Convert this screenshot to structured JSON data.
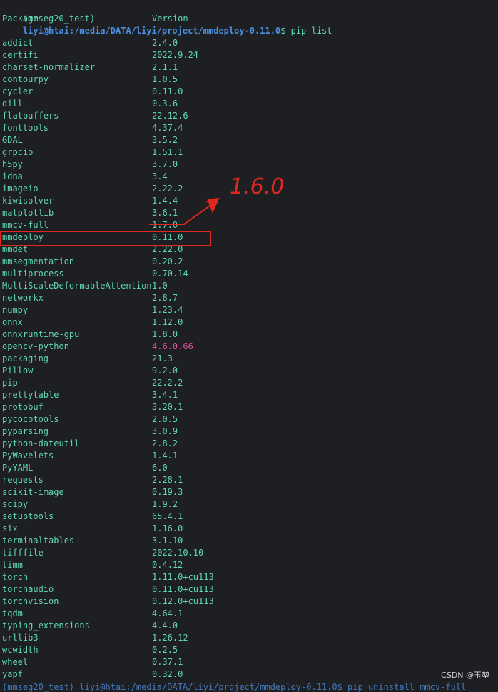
{
  "prompt": {
    "env": "(mmseg20_test)",
    "user_host": "liyi@htai",
    "path": ":/media/DATA/liyi/project/mmdeploy-0.11.0",
    "command": "$ pip list"
  },
  "table": {
    "header_package": "Package",
    "header_version": "Version",
    "separator_package": "------------------------------",
    "separator_version": "------------",
    "rows": [
      {
        "name": "addict",
        "version": "2.4.0"
      },
      {
        "name": "certifi",
        "version": "2022.9.24"
      },
      {
        "name": "charset-normalizer",
        "version": "2.1.1"
      },
      {
        "name": "contourpy",
        "version": "1.0.5"
      },
      {
        "name": "cycler",
        "version": "0.11.0"
      },
      {
        "name": "dill",
        "version": "0.3.6"
      },
      {
        "name": "flatbuffers",
        "version": "22.12.6"
      },
      {
        "name": "fonttools",
        "version": "4.37.4"
      },
      {
        "name": "GDAL",
        "version": "3.5.2"
      },
      {
        "name": "grpcio",
        "version": "1.51.1"
      },
      {
        "name": "h5py",
        "version": "3.7.0"
      },
      {
        "name": "idna",
        "version": "3.4"
      },
      {
        "name": "imageio",
        "version": "2.22.2"
      },
      {
        "name": "kiwisolver",
        "version": "1.4.4"
      },
      {
        "name": "matplotlib",
        "version": "3.6.1"
      },
      {
        "name": "mmcv-full",
        "version": "1.7.0"
      },
      {
        "name": "mmdeploy",
        "version": "0.11.0"
      },
      {
        "name": "mmdet",
        "version": "2.22.0"
      },
      {
        "name": "mmsegmentation",
        "version": "0.20.2"
      },
      {
        "name": "multiprocess",
        "version": "0.70.14"
      },
      {
        "name": "MultiScaleDeformableAttention",
        "version": "1.0"
      },
      {
        "name": "networkx",
        "version": "2.8.7"
      },
      {
        "name": "numpy",
        "version": "1.23.4"
      },
      {
        "name": "onnx",
        "version": "1.12.0"
      },
      {
        "name": "onnxruntime-gpu",
        "version": "1.8.0"
      },
      {
        "name": "opencv-python",
        "version": "4.6.0.66"
      },
      {
        "name": "packaging",
        "version": "21.3"
      },
      {
        "name": "Pillow",
        "version": "9.2.0"
      },
      {
        "name": "pip",
        "version": "22.2.2"
      },
      {
        "name": "prettytable",
        "version": "3.4.1"
      },
      {
        "name": "protobuf",
        "version": "3.20.1"
      },
      {
        "name": "pycocotools",
        "version": "2.0.5"
      },
      {
        "name": "pyparsing",
        "version": "3.0.9"
      },
      {
        "name": "python-dateutil",
        "version": "2.8.2"
      },
      {
        "name": "PyWavelets",
        "version": "1.4.1"
      },
      {
        "name": "PyYAML",
        "version": "6.0"
      },
      {
        "name": "requests",
        "version": "2.28.1"
      },
      {
        "name": "scikit-image",
        "version": "0.19.3"
      },
      {
        "name": "scipy",
        "version": "1.9.2"
      },
      {
        "name": "setuptools",
        "version": "65.4.1"
      },
      {
        "name": "six",
        "version": "1.16.0"
      },
      {
        "name": "terminaltables",
        "version": "3.1.10"
      },
      {
        "name": "tifffile",
        "version": "2022.10.10"
      },
      {
        "name": "timm",
        "version": "0.4.12"
      },
      {
        "name": "torch",
        "version": "1.11.0+cu113"
      },
      {
        "name": "torchaudio",
        "version": "0.11.0+cu113"
      },
      {
        "name": "torchvision",
        "version": "0.12.0+cu113"
      },
      {
        "name": "tqdm",
        "version": "4.64.1"
      },
      {
        "name": "typing_extensions",
        "version": "4.4.0"
      },
      {
        "name": "urllib3",
        "version": "1.26.12"
      },
      {
        "name": "wcwidth",
        "version": "0.2.5"
      },
      {
        "name": "wheel",
        "version": "0.37.1"
      },
      {
        "name": "yapf",
        "version": "0.32.0"
      }
    ]
  },
  "annotation": {
    "handwritten_text": "1.6.0",
    "color": "#e0281e"
  },
  "colors": {
    "background": "#1e1f22",
    "text": "#5fd7b4",
    "prompt_blue": "#4a90e2",
    "opencv_version": "#e64fa0"
  },
  "watermark": "CSDN @玉堃",
  "next_prompt_partial": "(mmseg20_test) liyi@htai:/media/DATA/liyi/project/mmdeploy-0.11.0$ pip uninstall mmcv-full"
}
